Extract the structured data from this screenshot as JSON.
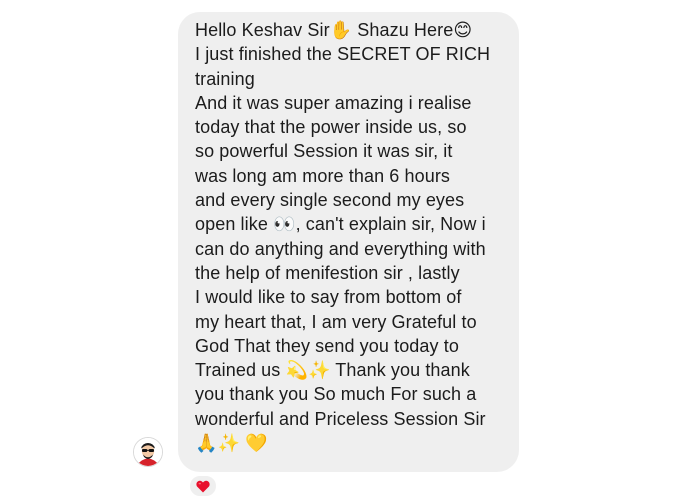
{
  "message": {
    "lines": [
      "Hello Keshav Sir✋ Shazu Here😊",
      "I just finished the SECRET OF RICH",
      "training",
      "And it was super amazing i realise",
      "today that the power inside us, so",
      "so powerful Session it was sir, it",
      "was long am more than 6 hours",
      "and every single second my eyes",
      "open like 👀, can't explain sir, Now i",
      "can do anything and everything with",
      "the help of menifestion sir , lastly",
      "I would like to say from bottom of",
      "my heart that, I am very Grateful to",
      "God That they send you today to",
      "Trained us 💫✨ Thank you thank",
      "you thank you So much For such a",
      "wonderful and Priceless Session Sir",
      "🙏✨ 💛"
    ]
  },
  "reaction": {
    "icon": "red-heart-icon",
    "color": "#e8112d"
  },
  "avatar": {
    "icon": "sender-avatar-icon",
    "accent": "#d6222a"
  },
  "colors": {
    "bubble": "#efefef",
    "text": "#1c1c1c"
  }
}
